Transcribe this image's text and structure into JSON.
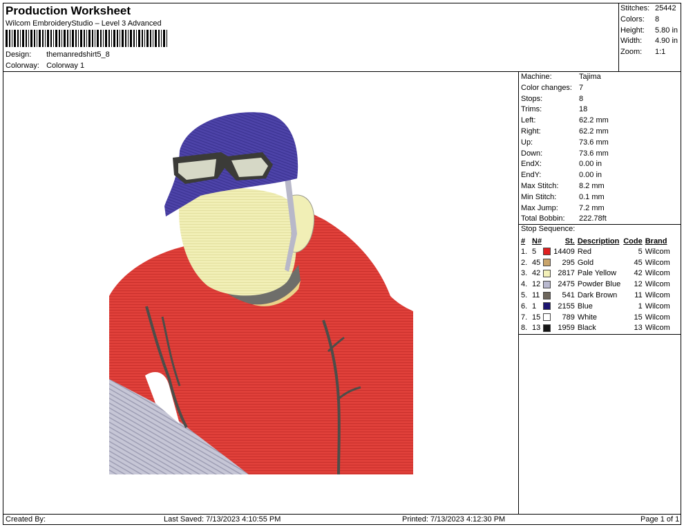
{
  "header": {
    "title": "Production Worksheet",
    "subtitle": "Wilcom EmbroideryStudio – Level 3 Advanced",
    "design_label": "Design:",
    "design_value": "themanredshirt5_8",
    "colorway_label": "Colorway:",
    "colorway_value": "Colorway 1"
  },
  "stats": [
    {
      "label": "Stitches:",
      "value": "25442"
    },
    {
      "label": "Colors:",
      "value": "8"
    },
    {
      "label": "Height:",
      "value": "5.80 in"
    },
    {
      "label": "Width:",
      "value": "4.90 in"
    },
    {
      "label": "Zoom:",
      "value": "1:1"
    }
  ],
  "machine_info": [
    {
      "label": "Machine:",
      "value": "Tajima"
    },
    {
      "label": "Color changes:",
      "value": "7"
    },
    {
      "label": "Stops:",
      "value": "8"
    },
    {
      "label": "Trims:",
      "value": "18"
    },
    {
      "label": "Left:",
      "value": "62.2 mm"
    },
    {
      "label": "Right:",
      "value": "62.2 mm"
    },
    {
      "label": "Up:",
      "value": "73.6 mm"
    },
    {
      "label": "Down:",
      "value": "73.6 mm"
    },
    {
      "label": "EndX:",
      "value": "0.00 in"
    },
    {
      "label": "EndY:",
      "value": "0.00 in"
    },
    {
      "label": "Max Stitch:",
      "value": "8.2 mm"
    },
    {
      "label": "Min Stitch:",
      "value": "0.1 mm"
    },
    {
      "label": "Max Jump:",
      "value": "7.2 mm"
    },
    {
      "label": "Total Bobbin:",
      "value": "222.78ft"
    }
  ],
  "stop_sequence": {
    "label": "Stop Sequence:",
    "headers": [
      "#",
      "N#",
      "St.",
      "Description",
      "Code",
      "Brand"
    ],
    "rows": [
      {
        "idx": "1.",
        "n": "5",
        "color": "#e02020",
        "st": "14409",
        "desc": "Red",
        "code": "5",
        "brand": "Wilcom"
      },
      {
        "idx": "2.",
        "n": "45",
        "color": "#c9a46a",
        "st": "295",
        "desc": "Gold",
        "code": "45",
        "brand": "Wilcom"
      },
      {
        "idx": "3.",
        "n": "42",
        "color": "#f3f0b8",
        "st": "2817",
        "desc": "Pale Yellow",
        "code": "42",
        "brand": "Wilcom"
      },
      {
        "idx": "4.",
        "n": "12",
        "color": "#b9b9cf",
        "st": "2475",
        "desc": "Powder Blue",
        "code": "12",
        "brand": "Wilcom"
      },
      {
        "idx": "5.",
        "n": "11",
        "color": "#6e675d",
        "st": "541",
        "desc": "Dark Brown",
        "code": "11",
        "brand": "Wilcom"
      },
      {
        "idx": "6.",
        "n": "1",
        "color": "#1c1470",
        "st": "2155",
        "desc": "Blue",
        "code": "1",
        "brand": "Wilcom"
      },
      {
        "idx": "7.",
        "n": "15",
        "color": "#ffffff",
        "st": "789",
        "desc": "White",
        "code": "15",
        "brand": "Wilcom"
      },
      {
        "idx": "8.",
        "n": "13",
        "color": "#151515",
        "st": "1959",
        "desc": "Black",
        "code": "13",
        "brand": "Wilcom"
      }
    ]
  },
  "footer": {
    "created_by": "Created By:",
    "last_saved": "Last Saved: 7/13/2023 4:10:55 PM",
    "printed": "Printed: 7/13/2023 4:12:30 PM",
    "page": "Page 1 of 1"
  }
}
